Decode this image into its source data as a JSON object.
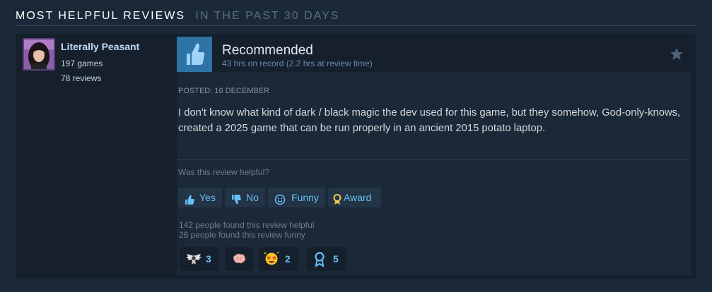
{
  "header": {
    "title": "Most Helpful Reviews",
    "subtitle": "In the past 30 days"
  },
  "author": {
    "name": "Literally Peasant",
    "games": "197 games",
    "reviews": "78 reviews"
  },
  "review": {
    "verdict": "Recommended",
    "hours": "43 hrs on record (2.2 hrs at review time)",
    "posted": "Posted: 16 December",
    "text": "I don't know what kind of dark / black magic the dev used for this game, but they somehow, God-only-knows, created a 2025 game that can be run properly in an ancient 2015 potato laptop."
  },
  "helpful": {
    "question": "Was this review helpful?",
    "yes_label": "Yes",
    "no_label": "No",
    "funny_label": "Funny",
    "award_label": "Award"
  },
  "stats": {
    "helpful_count_text": "142 people found this review helpful",
    "funny_count_text": "26 people found this review funny"
  },
  "reactions": [
    {
      "icon": "winged-award-icon",
      "count": "3"
    },
    {
      "icon": "brain-icon",
      "count": ""
    },
    {
      "icon": "starstruck-face-icon",
      "count": "2"
    },
    {
      "icon": "medal-ribbon-icon",
      "count": "5"
    }
  ],
  "colors": {
    "background": "#1b2838",
    "panel": "#16202d",
    "accent": "#66c0f4",
    "thumb_box": "#2d73a6"
  }
}
